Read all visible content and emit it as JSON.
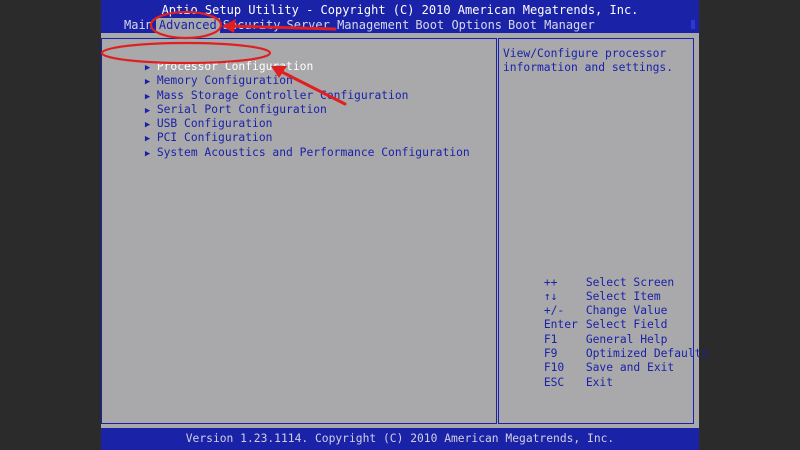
{
  "header": {
    "title": "Aptio Setup Utility - Copyright (C) 2010 American Megatrends, Inc.",
    "tabs": [
      "Main",
      "Advanced",
      "Security",
      "Server Management",
      "Boot Options",
      "Boot Manager"
    ]
  },
  "menu": {
    "items": [
      {
        "label": "Processor Configuration",
        "selected": true
      },
      {
        "label": "Memory Configuration"
      },
      {
        "label": "Mass Storage Controller Configuration"
      },
      {
        "label": "Serial Port Configuration"
      },
      {
        "label": "USB Configuration"
      },
      {
        "label": "PCI Configuration"
      },
      {
        "label": "System Acoustics and Performance Configuration"
      }
    ]
  },
  "help": {
    "text": "View/Configure processor information and settings.",
    "keys": [
      {
        "key": "++",
        "action": "Select Screen"
      },
      {
        "key": "↑↓",
        "action": "Select Item"
      },
      {
        "key": "+/-",
        "action": "Change Value"
      },
      {
        "key": "Enter",
        "action": "Select Field"
      },
      {
        "key": "F1",
        "action": "General Help"
      },
      {
        "key": "F9",
        "action": "Optimized Defaults"
      },
      {
        "key": "F10",
        "action": "Save and Exit"
      },
      {
        "key": "ESC",
        "action": "Exit"
      }
    ]
  },
  "footer": {
    "text": "Version 1.23.1114. Copyright (C) 2010 American Megatrends, Inc."
  },
  "colors": {
    "bios_blue": "#1a22a8",
    "bios_gray": "#a9a9ab",
    "annotation_red": "#e02020"
  },
  "icons": {
    "submenu_marker": "right-triangle-icon"
  }
}
